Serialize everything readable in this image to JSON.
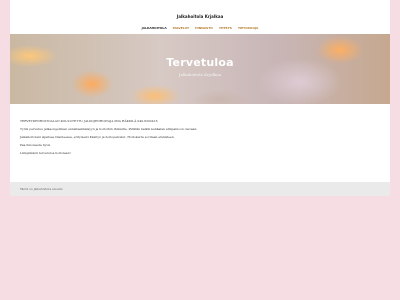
{
  "site": {
    "title": "Jalkahoitola Krjalkaa"
  },
  "nav": {
    "items": [
      {
        "label": "JALKAHOITOLA"
      },
      {
        "label": "PALVELUT"
      },
      {
        "label": "HINNASTO"
      },
      {
        "label": "YHTEYS"
      },
      {
        "label": "TIETOSUOJA"
      }
    ]
  },
  "hero": {
    "title": "Tervetuloa",
    "subtitle": "Jalkahoitola Krjalkaa"
  },
  "content": {
    "paragraphs": [
      "TERVEYDENHOITOALAN KOULUTETTU JALKOJENHOITAJA PIIA HÄKKILÄ 040-8202416",
      "Työni perustuu jalkaongelmien ennaltaehkäisyyn ja hoitoihin ihmisille. Pidätän kaikki kehäalan alinpainoon olevaan.",
      "Jalkahoitolani sijaitsee tilanteessa, erityisesti Käsityö ja hoitopalvelut. Hoitokerta sovitaan etukäteen.",
      "Paa ilmoisesta hyvä",
      "Lämpimästi tervetuloa hoitolaan!"
    ]
  },
  "footer": {
    "text": "Tämä on Jalkahoitola sivusto"
  },
  "colors": {
    "background": "#f6dde4",
    "nav_link": "#b57a2a",
    "footer": "#eaeaea"
  }
}
